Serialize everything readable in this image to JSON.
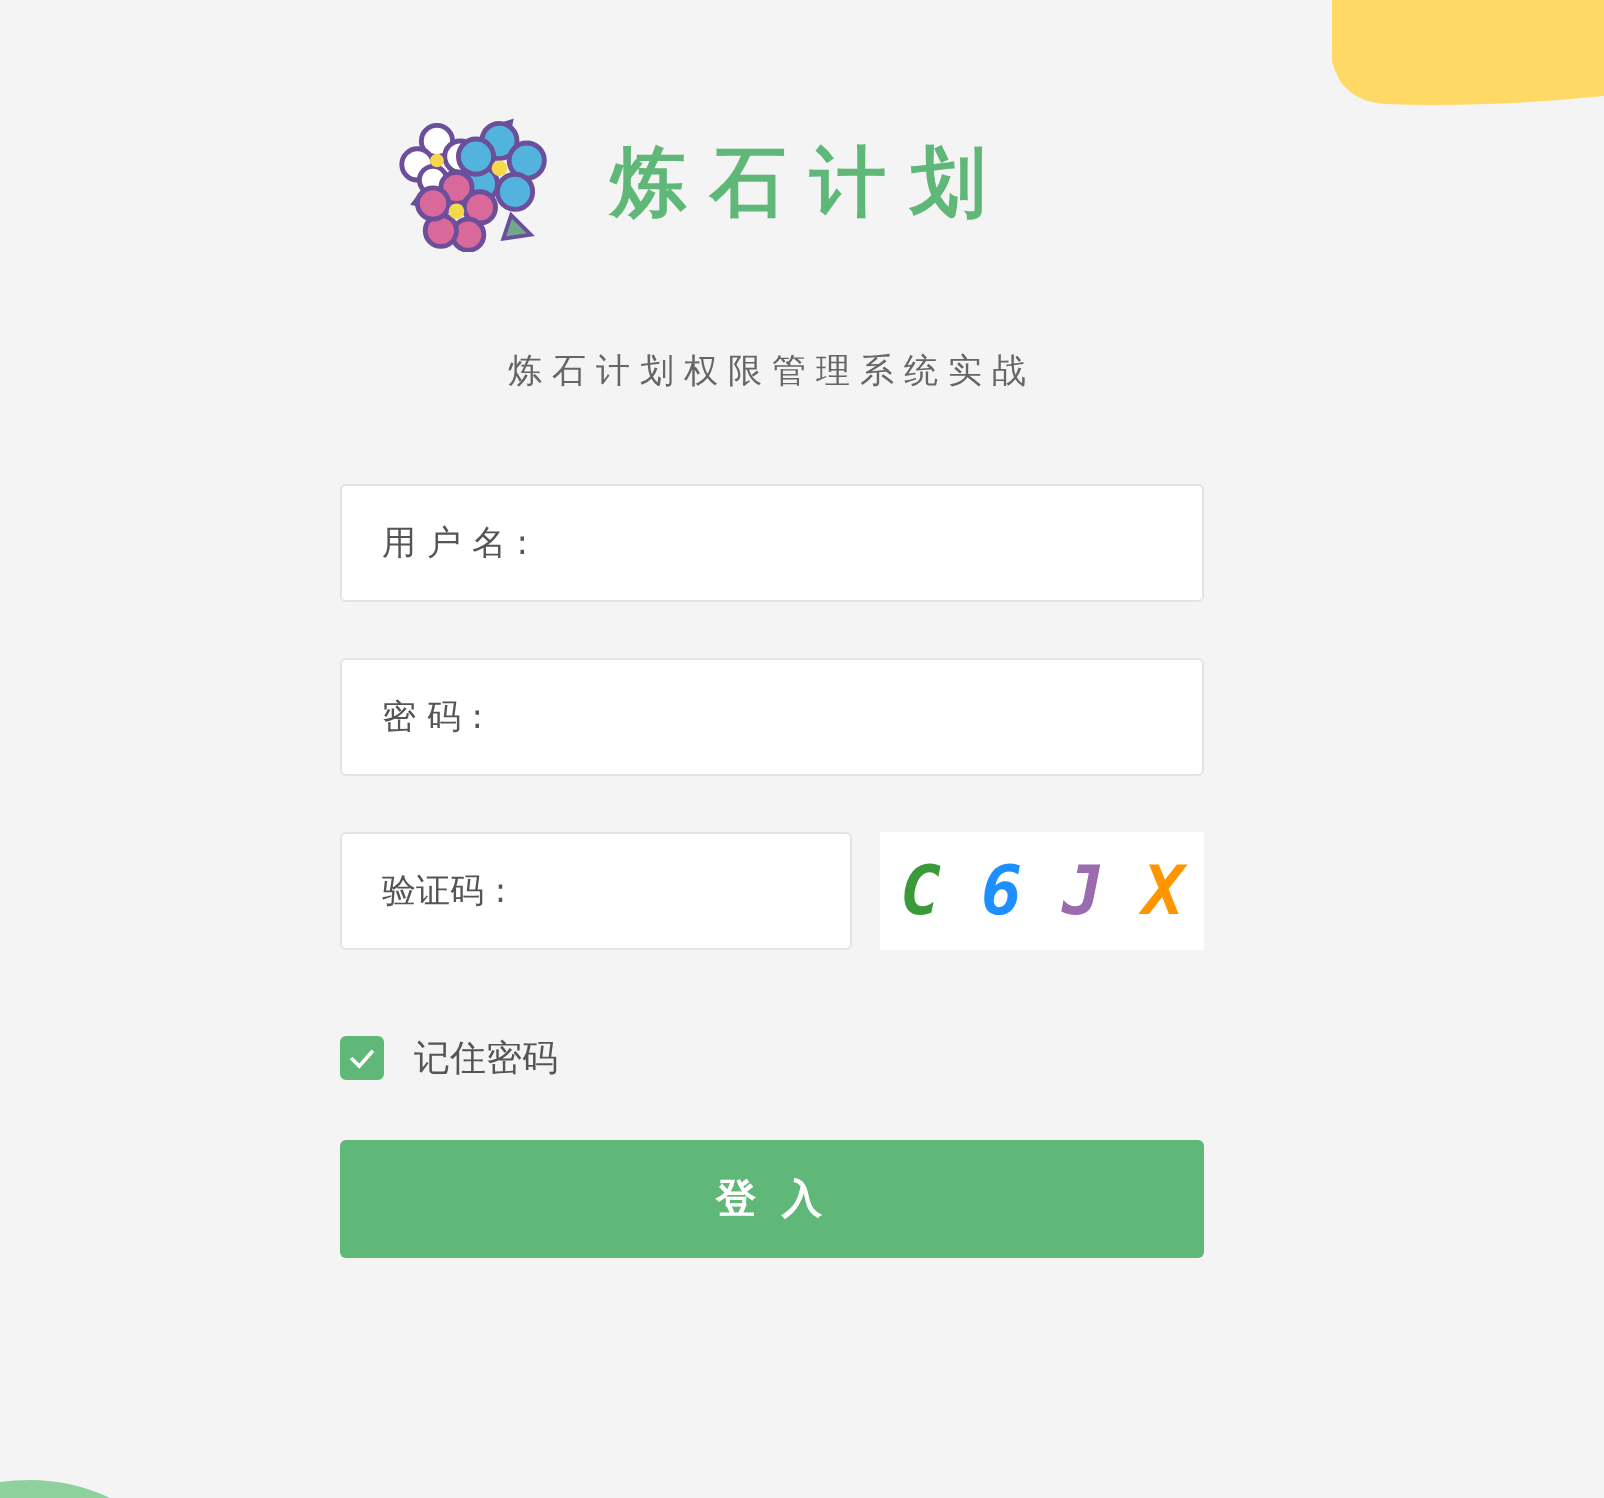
{
  "brand": {
    "title": "炼石计划"
  },
  "subtitle": "炼石计划权限管理系统实战",
  "fields": [
    {
      "placeholder": "用 户 名 :"
    },
    {
      "placeholder": "密 码 :"
    }
  ],
  "captcha": {
    "placeholder": "验证码 :",
    "chars": [
      {
        "char": "C",
        "color": "#3a9a3a"
      },
      {
        "char": "6",
        "color": "#1e8fff"
      },
      {
        "char": "J",
        "color": "#9b6bb0"
      },
      {
        "char": "X",
        "color": "#ff9500"
      }
    ]
  },
  "remember": {
    "label": "记住密码",
    "checked": true
  },
  "login_button": "登 入"
}
